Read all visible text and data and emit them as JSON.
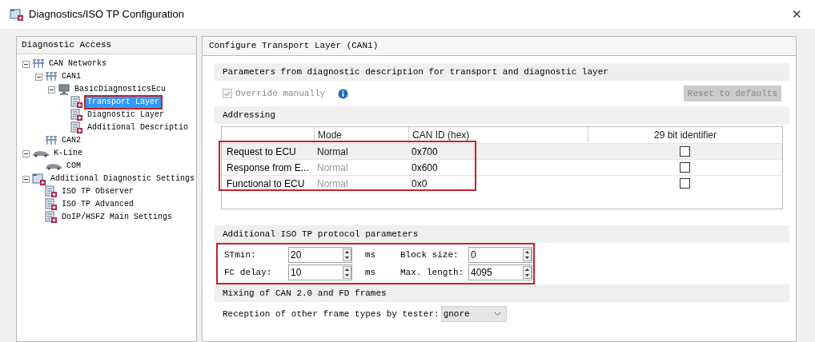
{
  "window": {
    "title": "Diagnostics/ISO TP Configuration",
    "close": "✕"
  },
  "sidebar": {
    "title": "Diagnostic Access",
    "tree": [
      {
        "label": "CAN Networks",
        "kind": "network",
        "expanded": true,
        "selected": false,
        "highlighted": false,
        "children": [
          {
            "label": "CAN1",
            "kind": "network",
            "expanded": true,
            "selected": false,
            "highlighted": false,
            "children": [
              {
                "label": "BasicDiagnosticsEcu",
                "kind": "ecu",
                "expanded": true,
                "selected": false,
                "highlighted": false,
                "children": [
                  {
                    "label": "Transport Layer",
                    "kind": "doc",
                    "selected": true,
                    "highlighted": true
                  },
                  {
                    "label": "Diagnostic Layer",
                    "kind": "doc",
                    "selected": false,
                    "highlighted": false
                  },
                  {
                    "label": "Additional Descriptio",
                    "kind": "doc",
                    "selected": false,
                    "highlighted": false
                  }
                ]
              }
            ]
          },
          {
            "label": "CAN2",
            "kind": "network",
            "selected": false,
            "highlighted": false
          }
        ]
      },
      {
        "label": "K-Line",
        "kind": "car",
        "expanded": true,
        "selected": false,
        "highlighted": false,
        "children": [
          {
            "label": "COM",
            "kind": "car",
            "selected": false,
            "highlighted": false
          }
        ]
      },
      {
        "label": "Additional Diagnostic Settings",
        "kind": "folder",
        "expanded": true,
        "selected": false,
        "highlighted": false,
        "children": [
          {
            "label": "ISO TP Observer",
            "kind": "doc",
            "selected": false,
            "highlighted": false
          },
          {
            "label": "ISO TP Advanced",
            "kind": "doc",
            "selected": false,
            "highlighted": false
          },
          {
            "label": "DoIP/HSFZ Main Settings",
            "kind": "doc",
            "selected": false,
            "highlighted": false
          }
        ]
      }
    ]
  },
  "main": {
    "title": "Configure Transport Layer (CAN1)",
    "parameters": {
      "title": "Parameters from diagnostic description for transport and diagnostic layer",
      "override": {
        "label": "Override manually",
        "checked": true,
        "disabled": true
      },
      "reset_button": {
        "label": "Reset to defaults",
        "disabled": true
      }
    },
    "addressing": {
      "title": "Addressing",
      "highlighted": true,
      "columns": [
        "Mode",
        "CAN ID (hex)",
        "29 bit identifier"
      ],
      "rows": [
        {
          "label": "Request to ECU",
          "mode": "Normal",
          "mode_disabled": false,
          "can_id": "0x700",
          "extended": false,
          "selected": true
        },
        {
          "label": "Response from E...",
          "mode": "Normal",
          "mode_disabled": true,
          "can_id": "0x600",
          "extended": false,
          "selected": false
        },
        {
          "label": "Functional to ECU",
          "mode": "Normal",
          "mode_disabled": true,
          "can_id": "0x0",
          "extended": false,
          "selected": false
        }
      ]
    },
    "iso_tp": {
      "title": "Additional ISO TP protocol parameters",
      "highlighted": true,
      "fields": [
        {
          "label": "STmin:",
          "value": "20",
          "unit": "ms"
        },
        {
          "label": "Block size:",
          "value": "0"
        },
        {
          "label": "FC delay:",
          "value": "10",
          "unit": "ms"
        },
        {
          "label": "Max. length:",
          "value": "4095"
        }
      ]
    },
    "mixing": {
      "title": "Mixing of CAN 2.0 and FD frames",
      "label": "Reception of other frame types by tester:",
      "value": "gnore"
    }
  }
}
